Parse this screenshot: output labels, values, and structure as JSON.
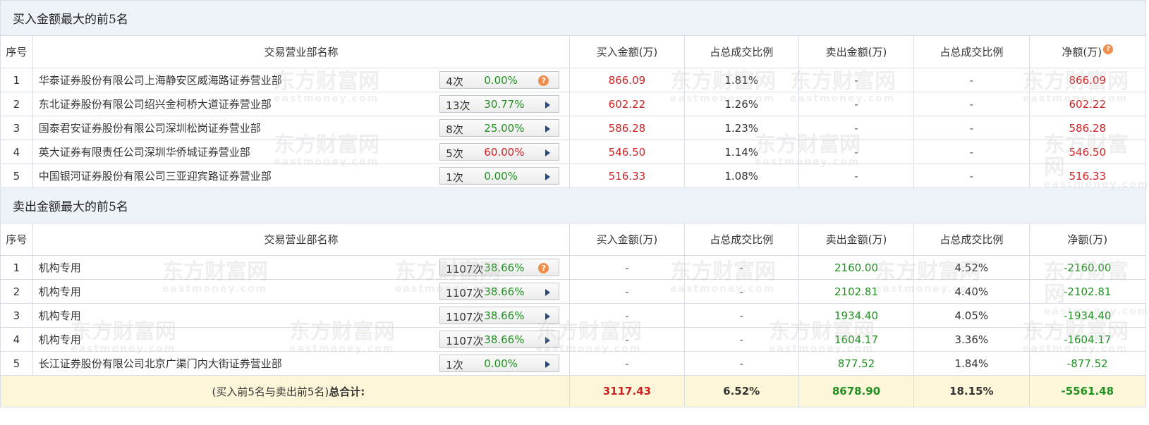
{
  "sections": {
    "buy_title": "买入金额最大的前5名",
    "sell_title": "卖出金额最大的前5名"
  },
  "headers": {
    "idx": "序号",
    "name": "交易营业部名称",
    "buy": "买入金额(万)",
    "buy_pct": "占总成交比例",
    "sell": "卖出金额(万)",
    "sell_pct": "占总成交比例",
    "net": "净额(万)"
  },
  "buy_rows": [
    {
      "idx": "1",
      "name": "华泰证券股份有限公司上海静安区威海路证券营业部",
      "count": "4次",
      "rate": "0.00%",
      "buy": "866.09",
      "buy_pct": "1.81%",
      "sell": "-",
      "sell_pct": "-",
      "net": "866.09"
    },
    {
      "idx": "2",
      "name": "东北证券股份有限公司绍兴金柯桥大道证券营业部",
      "count": "13次",
      "rate": "30.77%",
      "buy": "602.22",
      "buy_pct": "1.26%",
      "sell": "-",
      "sell_pct": "-",
      "net": "602.22"
    },
    {
      "idx": "3",
      "name": "国泰君安证券股份有限公司深圳松岗证券营业部",
      "count": "8次",
      "rate": "25.00%",
      "buy": "586.28",
      "buy_pct": "1.23%",
      "sell": "-",
      "sell_pct": "-",
      "net": "586.28"
    },
    {
      "idx": "4",
      "name": "英大证券有限责任公司深圳华侨城证券营业部",
      "count": "5次",
      "rate": "60.00%",
      "buy": "546.50",
      "buy_pct": "1.14%",
      "sell": "-",
      "sell_pct": "-",
      "net": "546.50"
    },
    {
      "idx": "5",
      "name": "中国银河证券股份有限公司三亚迎宾路证券营业部",
      "count": "1次",
      "rate": "0.00%",
      "buy": "516.33",
      "buy_pct": "1.08%",
      "sell": "-",
      "sell_pct": "-",
      "net": "516.33"
    }
  ],
  "sell_rows": [
    {
      "idx": "1",
      "name": "机构专用",
      "count": "1107次",
      "rate": "38.66%",
      "buy": "-",
      "buy_pct": "-",
      "sell": "2160.00",
      "sell_pct": "4.52%",
      "net": "-2160.00"
    },
    {
      "idx": "2",
      "name": "机构专用",
      "count": "1107次",
      "rate": "38.66%",
      "buy": "-",
      "buy_pct": "-",
      "sell": "2102.81",
      "sell_pct": "4.40%",
      "net": "-2102.81"
    },
    {
      "idx": "3",
      "name": "机构专用",
      "count": "1107次",
      "rate": "38.66%",
      "buy": "-",
      "buy_pct": "-",
      "sell": "1934.40",
      "sell_pct": "4.05%",
      "net": "-1934.40"
    },
    {
      "idx": "4",
      "name": "机构专用",
      "count": "1107次",
      "rate": "38.66%",
      "buy": "-",
      "buy_pct": "-",
      "sell": "1604.17",
      "sell_pct": "3.36%",
      "net": "-1604.17"
    },
    {
      "idx": "5",
      "name": "长江证券股份有限公司北京广渠门内大街证券营业部",
      "count": "1次",
      "rate": "0.00%",
      "buy": "-",
      "buy_pct": "-",
      "sell": "877.52",
      "sell_pct": "1.84%",
      "net": "-877.52"
    }
  ],
  "total": {
    "label_prefix": "(买入前5名与卖出前5名)",
    "label_bold": "总合计:",
    "buy": "3117.43",
    "buy_pct": "6.52%",
    "sell": "8678.90",
    "sell_pct": "18.15%",
    "net": "-5561.48"
  },
  "watermark": {
    "cn": "东方财富网",
    "en": "eastmoney.com"
  },
  "icons": {
    "help": "question-circle-icon",
    "expand": "triangle-right-icon"
  },
  "colors": {
    "up": "#cc2222",
    "down": "#209020",
    "section_bg": "#eef3fa",
    "total_bg": "#fdf6d8",
    "border": "#d6dde6"
  }
}
